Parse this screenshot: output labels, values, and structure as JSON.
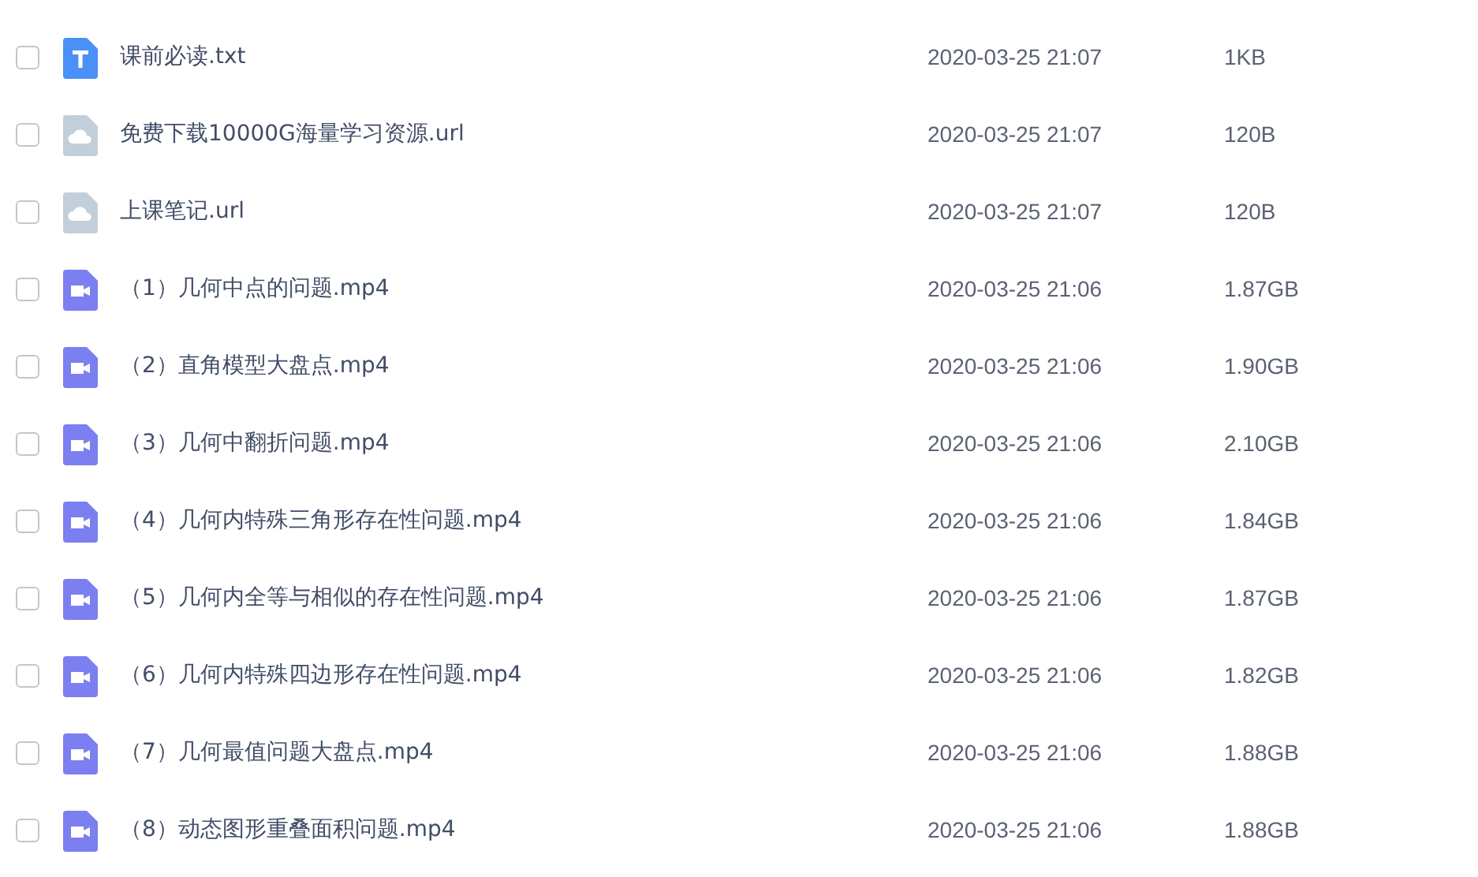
{
  "files": [
    {
      "kind": "text",
      "name": "课前必读.txt",
      "modified": "2020-03-25 21:07",
      "size": "1KB",
      "checked": false
    },
    {
      "kind": "link",
      "name": "免费下载10000G海量学习资源.url",
      "modified": "2020-03-25 21:07",
      "size": "120B",
      "checked": false
    },
    {
      "kind": "link",
      "name": "上课笔记.url",
      "modified": "2020-03-25 21:07",
      "size": "120B",
      "checked": false
    },
    {
      "kind": "video",
      "name": "（1）几何中点的问题.mp4",
      "modified": "2020-03-25 21:06",
      "size": "1.87GB",
      "checked": false
    },
    {
      "kind": "video",
      "name": "（2）直角模型大盘点.mp4",
      "modified": "2020-03-25 21:06",
      "size": "1.90GB",
      "checked": false
    },
    {
      "kind": "video",
      "name": "（3）几何中翻折问题.mp4",
      "modified": "2020-03-25 21:06",
      "size": "2.10GB",
      "checked": false
    },
    {
      "kind": "video",
      "name": "（4）几何内特殊三角形存在性问题.mp4",
      "modified": "2020-03-25 21:06",
      "size": "1.84GB",
      "checked": false
    },
    {
      "kind": "video",
      "name": "（5）几何内全等与相似的存在性问题.mp4",
      "modified": "2020-03-25 21:06",
      "size": "1.87GB",
      "checked": false
    },
    {
      "kind": "video",
      "name": "（6）几何内特殊四边形存在性问题.mp4",
      "modified": "2020-03-25 21:06",
      "size": "1.82GB",
      "checked": false
    },
    {
      "kind": "video",
      "name": "（7）几何最值问题大盘点.mp4",
      "modified": "2020-03-25 21:06",
      "size": "1.88GB",
      "checked": false
    },
    {
      "kind": "video",
      "name": "（8）动态图形重叠面积问题.mp4",
      "modified": "2020-03-25 21:06",
      "size": "1.88GB",
      "checked": false
    }
  ]
}
